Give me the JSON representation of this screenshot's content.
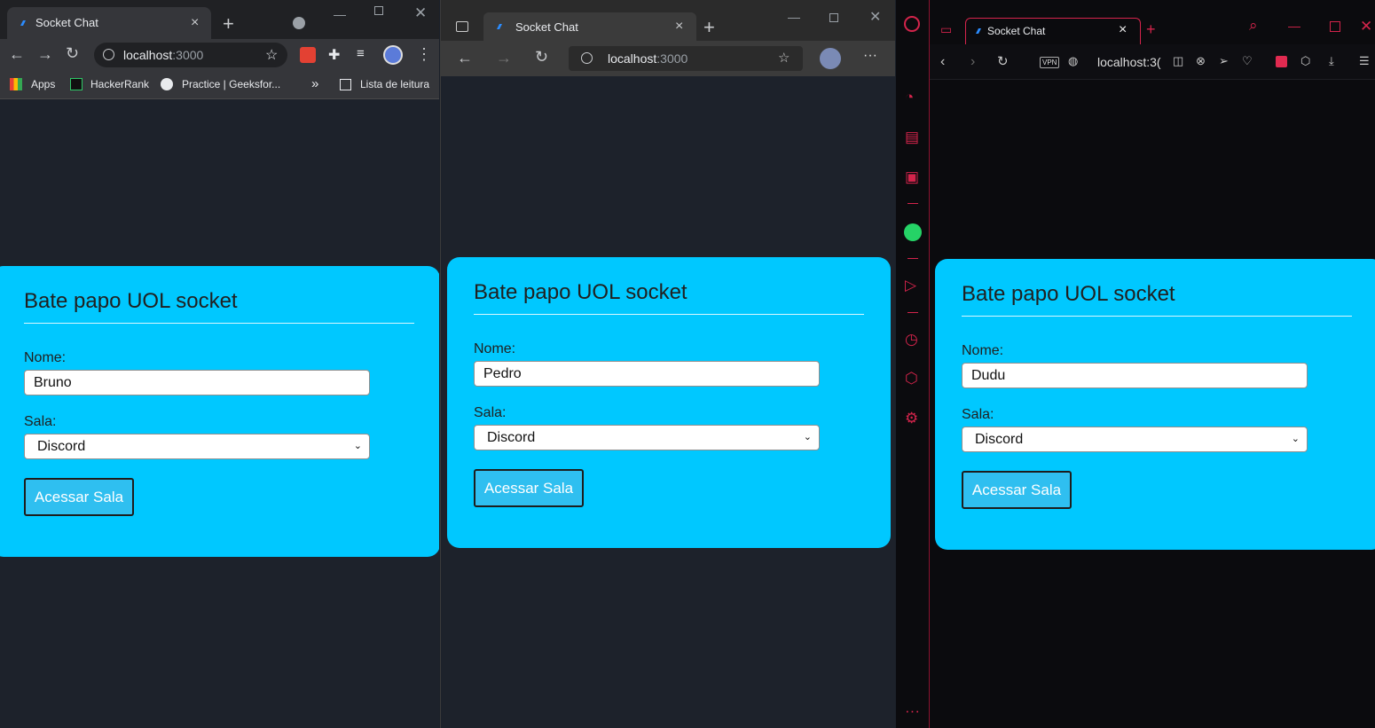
{
  "window1": {
    "tab_title": "Socket Chat",
    "url_host": "localhost",
    "url_port": ":3000",
    "bookmarks": [
      "Apps",
      "HackerRank",
      "Practice | Geeksfor...",
      "Lista de leitura"
    ],
    "bookmarks_overflow": "»"
  },
  "window2": {
    "tab_title": "Socket Chat",
    "url_host": "localhost",
    "url_port": ":3000"
  },
  "window3": {
    "tab_title": "Socket Chat",
    "url_host": "localhost:3(",
    "vpn_label": "VPN"
  },
  "cards": [
    {
      "title": "Bate papo UOL socket",
      "name_label": "Nome:",
      "name_value": "Bruno",
      "room_label": "Sala:",
      "room_value": "Discord",
      "button": "Acessar Sala"
    },
    {
      "title": "Bate papo UOL socket",
      "name_label": "Nome:",
      "name_value": "Pedro",
      "room_label": "Sala:",
      "room_value": "Discord",
      "button": "Acessar Sala"
    },
    {
      "title": "Bate papo UOL socket",
      "name_label": "Nome:",
      "name_value": "Dudu",
      "room_label": "Sala:",
      "room_value": "Discord",
      "button": "Acessar Sala"
    }
  ],
  "icons": {
    "close": "×",
    "new_tab": "+",
    "back": "←",
    "forward": "→",
    "reload": "↻",
    "more": "⋮",
    "chevron_down": "⌄"
  },
  "colors": {
    "card_bg": "#00c8ff",
    "button_bg": "#2fbff0",
    "opera_accent": "#d3244b",
    "page_bg": "#1d222b"
  }
}
